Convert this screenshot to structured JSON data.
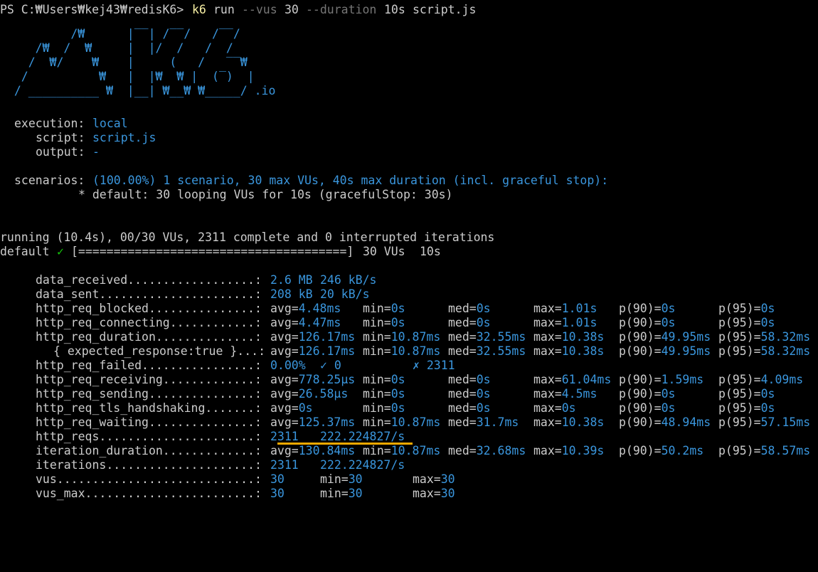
{
  "prompt": {
    "ps": "PS C:₩Users₩kej43₩redisK6>",
    "cmd": "k6",
    "args_run": "run",
    "flag_vus": "--vus",
    "vus_value": "30",
    "flag_duration": "--duration",
    "duration_value": "10s",
    "script": "script.js"
  },
  "logo": {
    "art": "          /₩      |‾‾| /‾‾/   /‾‾/\n     /₩  /  ₩     |  |/  /   /  /\n    /  ₩/    ₩    |     (   /   ‾‾₩\n   /          ₩   |  |₩  ₩ |  (‾)  |\n  / __________ ₩  |__| ₩__₩ ₩_____/ .io"
  },
  "options": {
    "execution_label": "execution:",
    "execution_value": "local",
    "script_label": "script:",
    "script_value": "script.js",
    "output_label": "output:",
    "output_value": "-",
    "scenarios_label": "scenarios:",
    "scenarios_value": "(100.00%) 1 scenario, 30 max VUs, 40s max duration (incl. graceful stop):",
    "default_line": "* default: 30 looping VUs for 10s (gracefulStop: 30s)"
  },
  "run_status": {
    "running": "running (10.4s), 00/30 VUs, 2311 complete and 0 interrupted iterations",
    "scenario_name": "default",
    "checkmark": "✓",
    "progress_bar": "[======================================]",
    "vus": "30 VUs",
    "duration": "10s"
  },
  "metrics": {
    "data_received": {
      "name": "data_received..................:",
      "v1": "2.6 MB",
      "v2": "246 kB/s"
    },
    "data_sent": {
      "name": "data_sent......................:",
      "v1": "208 kB",
      "v2": "20 kB/s"
    },
    "http_req_blocked": {
      "name": "http_req_blocked...............:",
      "avg": "4.48ms",
      "min": "0s",
      "med": "0s",
      "max": "1.01s",
      "p90": "0s",
      "p95": "0s"
    },
    "http_req_connecting": {
      "name": "http_req_connecting............:",
      "avg": "4.47ms",
      "min": "0s",
      "med": "0s",
      "max": "1.01s",
      "p90": "0s",
      "p95": "0s"
    },
    "http_req_duration": {
      "name": "http_req_duration..............:",
      "avg": "126.17ms",
      "min": "10.87ms",
      "med": "32.55ms",
      "max": "10.38s",
      "p90": "49.95ms",
      "p95": "58.32ms"
    },
    "expected_response": {
      "name": "{ expected_response:true }...:",
      "avg": "126.17ms",
      "min": "10.87ms",
      "med": "32.55ms",
      "max": "10.38s",
      "p90": "49.95ms",
      "p95": "58.32ms"
    },
    "http_req_failed": {
      "name": "http_req_failed................:",
      "rate": "0.00%",
      "pass": "✓ 0",
      "fail": "✗ 2311"
    },
    "http_req_receiving": {
      "name": "http_req_receiving.............:",
      "avg": "778.25µs",
      "min": "0s",
      "med": "0s",
      "max": "61.04ms",
      "p90": "1.59ms",
      "p95": "4.09ms"
    },
    "http_req_sending": {
      "name": "http_req_sending...............:",
      "avg": "26.58µs",
      "min": "0s",
      "med": "0s",
      "max": "4.5ms",
      "p90": "0s",
      "p95": "0s"
    },
    "http_req_tls_handshaking": {
      "name": "http_req_tls_handshaking.......:",
      "avg": "0s",
      "min": "0s",
      "med": "0s",
      "max": "0s",
      "p90": "0s",
      "p95": "0s"
    },
    "http_req_waiting": {
      "name": "http_req_waiting...............:",
      "avg": "125.37ms",
      "min": "10.87ms",
      "med": "31.7ms",
      "max": "10.38s",
      "p90": "48.94ms",
      "p95": "57.15ms"
    },
    "http_reqs": {
      "name": "http_reqs......................:",
      "v1": "2311",
      "v2": "222.224827/s"
    },
    "iteration_duration": {
      "name": "iteration_duration.............:",
      "avg": "130.84ms",
      "min": "10.87ms",
      "med": "32.68ms",
      "max": "10.39s",
      "p90": "50.2ms",
      "p95": "58.57ms"
    },
    "iterations": {
      "name": "iterations.....................:",
      "v1": "2311",
      "v2": "222.224827/s"
    },
    "vus": {
      "name": "vus............................:",
      "v1": "30",
      "min": "30",
      "max": "30"
    },
    "vus_max": {
      "name": "vus_max........................:",
      "v1": "30",
      "min": "30",
      "max": "30"
    }
  },
  "labels": {
    "avg": "avg=",
    "min": "min=",
    "med": "med=",
    "max": "max=",
    "p90": "p(90)=",
    "p95": "p(95)="
  },
  "colors": {
    "background": "#000000",
    "text": "#cccccc",
    "value": "#3a96dd",
    "command": "#f9f1a5",
    "muted": "#767676",
    "highlight_underline": "#f2a900"
  }
}
